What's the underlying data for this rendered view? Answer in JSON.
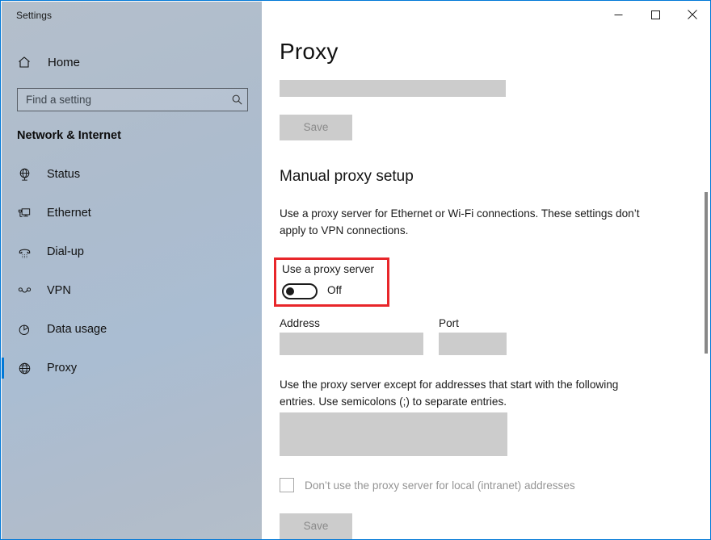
{
  "window": {
    "title": "Settings",
    "accent_color": "#0078d7",
    "controls": [
      {
        "name": "minimize",
        "glyph": "—"
      },
      {
        "name": "maximize",
        "glyph": "□"
      },
      {
        "name": "close",
        "glyph": "✕"
      }
    ]
  },
  "sidebar": {
    "home_label": "Home",
    "search": {
      "value": "",
      "placeholder": "Find a setting",
      "icon": "search-icon"
    },
    "section_header": "Network & Internet",
    "items": [
      {
        "label": "Status",
        "icon": "globe-status-icon",
        "selected": false
      },
      {
        "label": "Ethernet",
        "icon": "ethernet-icon",
        "selected": false
      },
      {
        "label": "Dial-up",
        "icon": "phone-dialup-icon",
        "selected": false
      },
      {
        "label": "VPN",
        "icon": "vpn-icon",
        "selected": false
      },
      {
        "label": "Data usage",
        "icon": "pie-chart-icon",
        "selected": false
      },
      {
        "label": "Proxy",
        "icon": "globe-icon",
        "selected": true
      }
    ]
  },
  "main": {
    "page_title": "Proxy",
    "script_address_value": "",
    "save_top_label": "Save",
    "manual": {
      "heading": "Manual proxy setup",
      "description": "Use a proxy server for Ethernet or Wi-Fi connections. These settings don’t apply to VPN connections.",
      "toggle_label": "Use a proxy server",
      "toggle_state": "Off",
      "highlight_color": "#e8262a"
    },
    "address_label": "Address",
    "address_value": "",
    "port_label": "Port",
    "port_value": "",
    "exceptions_description": "Use the proxy server except for addresses that start with the following entries. Use semicolons (;) to separate entries.",
    "exceptions_value": "",
    "bypass_local_label": "Don’t use the proxy server for local (intranet) addresses",
    "bypass_local_checked": false,
    "save_bottom_label": "Save"
  }
}
